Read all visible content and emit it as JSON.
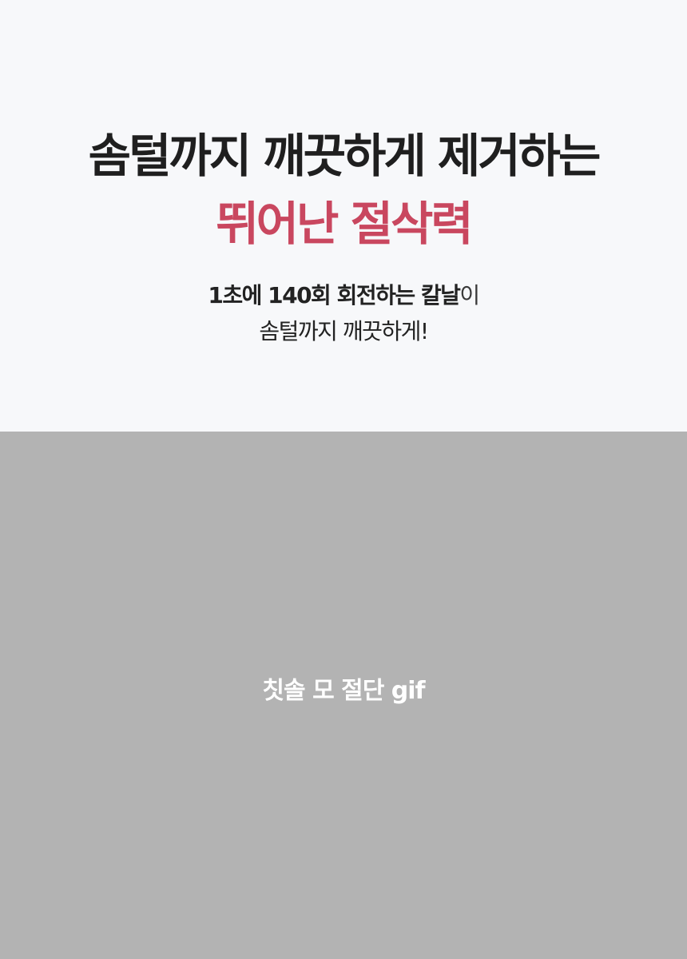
{
  "colors": {
    "top_background": "#f7f8fa",
    "headline": "#1f1f1f",
    "accent": "#c9475f",
    "placeholder_background": "#b3b3b3"
  },
  "hero": {
    "headline_line1": "솜털까지 깨끗하게 제거하는",
    "headline_line2": "뛰어난 절삭력",
    "sub_line1_bold": "1초에 140회 회전하는 칼날",
    "sub_line1_regular": "이",
    "sub_line2": "솜털까지 깨끗하게!"
  },
  "media_placeholder": {
    "label": "칫솔 모 절단 gif"
  }
}
